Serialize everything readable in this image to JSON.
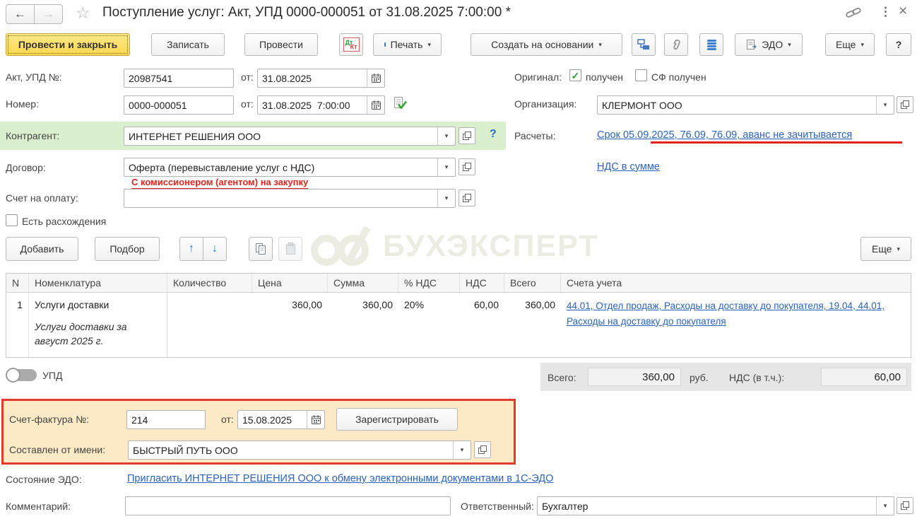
{
  "window": {
    "title": "Поступление услуг: Акт, УПД 0000-000051 от 31.08.2025 7:00:00 *"
  },
  "icons": {
    "back": "←",
    "forward": "→",
    "star": "☆",
    "kebab": "⋮",
    "close": "×",
    "caret": "▾",
    "up": "↑",
    "down": "↓",
    "check": "✓"
  },
  "toolbar": {
    "post_and_close": "Провести и закрыть",
    "save": "Записать",
    "post": "Провести",
    "dtkt_dt": "Дт",
    "dtkt_kt": "Кт",
    "print": "Печать",
    "create_based_on": "Создать на основании",
    "edo": "ЭДО",
    "more": "Еще",
    "help": "?"
  },
  "header_fields": {
    "act_no_label": "Акт, УПД №:",
    "act_no": "20987541",
    "act_from_label": "от:",
    "act_date": "31.08.2025",
    "number_label": "Номер:",
    "number": "0000-000051",
    "number_from_label": "от:",
    "number_date": "31.08.2025  7:00:00",
    "original_label": "Оригинал:",
    "received_label": "получен",
    "sf_received_label": "СФ получен",
    "org_label": "Организация:",
    "org": "КЛЕРМОНТ ООО",
    "counterparty_label": "Контрагент:",
    "counterparty": "ИНТЕРНЕТ РЕШЕНИЯ ООО",
    "counterparty_help": "?",
    "settlements_label": "Расчеты:",
    "settlements_link": "Срок 05.09.2025, 76.09, 76.09, аванс не зачитывается",
    "vat_link": "НДС в сумме",
    "contract_label": "Договор:",
    "contract": "Оферта (перевыставление услуг с НДС)",
    "contract_note": "С комиссионером (агентом) на закупку",
    "payment_invoice_label": "Счет на оплату:",
    "payment_invoice": "",
    "discrepancies_label": "Есть расхождения"
  },
  "table_commands": {
    "add": "Добавить",
    "pick": "Подбор",
    "more": "Еще"
  },
  "items_table": {
    "headers": [
      "N",
      "Номенклатура",
      "Количество",
      "Цена",
      "Сумма",
      "% НДС",
      "НДС",
      "Всего",
      "Счета учета"
    ],
    "rows": [
      {
        "n": "1",
        "nomenclature": "Услуги доставки",
        "note": "Услуги доставки за август 2025 г.",
        "qty": "",
        "price": "360,00",
        "sum": "360,00",
        "vat_rate": "20%",
        "vat": "60,00",
        "total": "360,00",
        "accounts": "44.01, Отдел продаж, Расходы на доставку до покупателя, 19.04, 44.01, Расходы на доставку до покупателя"
      }
    ]
  },
  "upd_toggle": {
    "label": "УПД"
  },
  "totals": {
    "total_label": "Всего:",
    "total": "360,00",
    "currency": "руб.",
    "vat_label": "НДС (в т.ч.):",
    "vat": "60,00"
  },
  "invoice_section": {
    "number_label": "Счет-фактура №:",
    "number": "214",
    "from_label": "от:",
    "date": "15.08.2025",
    "register": "Зарегистрировать",
    "issued_by_label": "Составлен от имени:",
    "issued_by": "БЫСТРЫЙ ПУТЬ ООО"
  },
  "edo": {
    "label": "Состояние ЭДО:",
    "link": "Пригласить ИНТЕРНЕТ РЕШЕНИЯ ООО к обмену электронными документами в 1С-ЭДО"
  },
  "footer": {
    "comment_label": "Комментарий:",
    "comment": "",
    "responsible_label": "Ответственный:",
    "responsible": "Бухгалтер"
  },
  "watermark": {
    "text": "БУХЭКСПЕРТ"
  },
  "colors": {
    "primary_yellow": "#ffe15e",
    "counterparty_row_green": "#d9efcd",
    "link_blue": "#2a63bd",
    "annotation_red": "#e0231c",
    "invoice_bg": "#fce9c6",
    "invoice_border": "#e23b2e"
  }
}
